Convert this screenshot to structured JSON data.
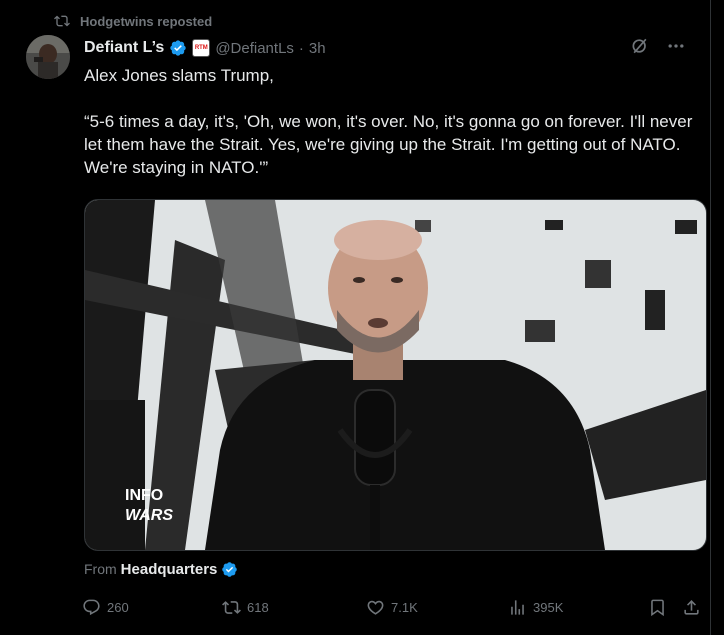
{
  "repost": {
    "label": "Hodgetwins reposted"
  },
  "author": {
    "name": "Defiant L’s",
    "affiliate_badge_text": "RTM",
    "handle": "@DefiantLs",
    "separator": "·",
    "time": "3h"
  },
  "tweet": {
    "line1": "Alex Jones slams Trump,",
    "line2": "“5-6 times a day, it's, 'Oh, we won, it's over. No, it's gonna go on forever. I'll never let them have the Strait. Yes, we're giving up the Strait. I'm getting out of NATO. We're staying in NATO.'”"
  },
  "media": {
    "watermark_line1": "INFO",
    "watermark_line2": "WARS"
  },
  "source": {
    "prefix": "From",
    "name": "Headquarters"
  },
  "actions": {
    "replies": "260",
    "reposts": "618",
    "likes": "7.1K",
    "views": "395K"
  },
  "colors": {
    "background": "#000000",
    "text": "#e7e9ea",
    "muted": "#71767b",
    "verified": "#1d9bf0",
    "repost_green": "#71767b"
  },
  "icons": {
    "repost": "repost-icon",
    "verified": "verified-badge-icon",
    "grok": "grok-icon",
    "more": "more-icon",
    "reply": "reply-icon",
    "like": "heart-icon",
    "views": "views-icon",
    "bookmark": "bookmark-icon",
    "share": "share-icon"
  }
}
